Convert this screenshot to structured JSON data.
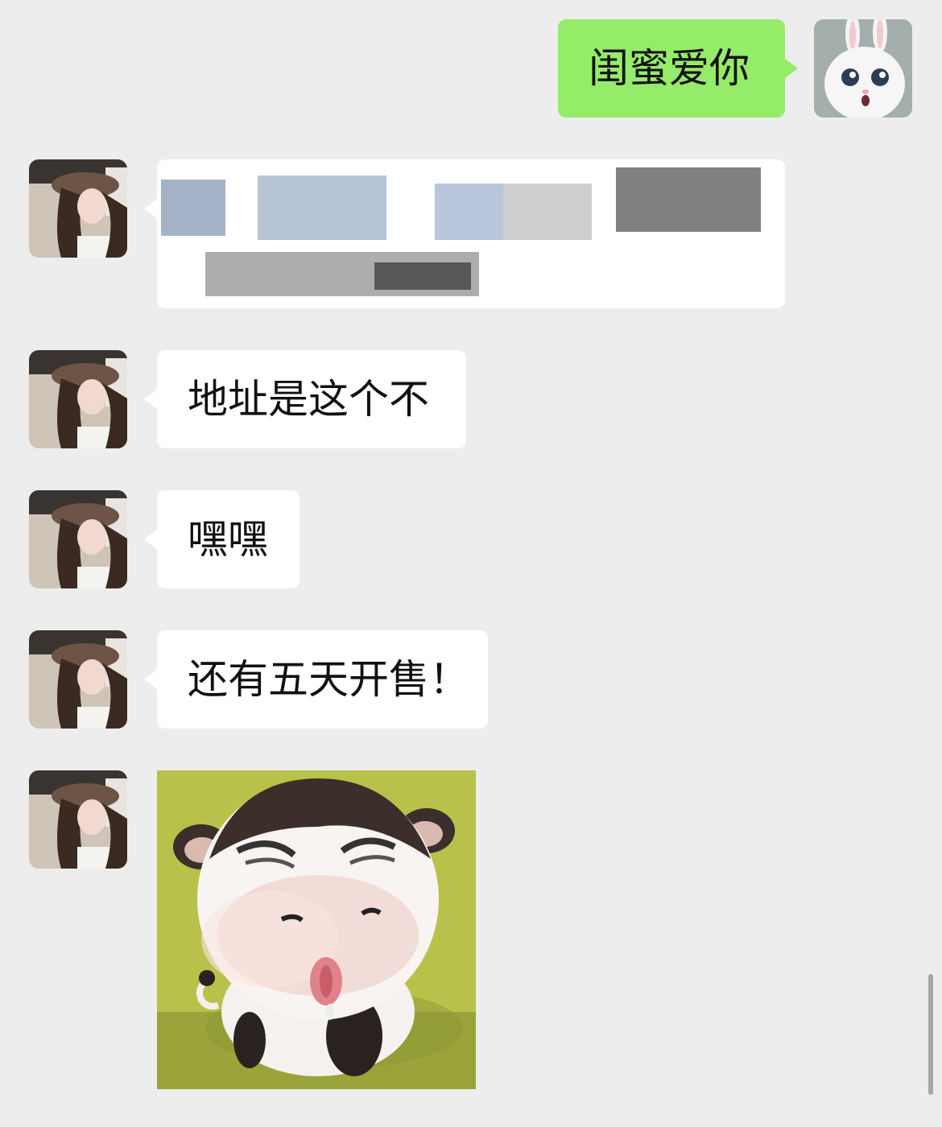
{
  "chat": {
    "messages": [
      {
        "sender": "me",
        "type": "text",
        "text": "闺蜜爱你"
      },
      {
        "sender": "friend",
        "type": "redacted"
      },
      {
        "sender": "friend",
        "type": "text",
        "text": "地址是这个不"
      },
      {
        "sender": "friend",
        "type": "text",
        "text": "嘿嘿"
      },
      {
        "sender": "friend",
        "type": "text",
        "text": "还有五天开售！"
      },
      {
        "sender": "friend",
        "type": "sticker",
        "icon": "cow-sticker"
      }
    ]
  },
  "colors": {
    "background": "#ededed",
    "incoming_bubble": "#ffffff",
    "outgoing_bubble": "#95ec69",
    "text": "#111111"
  }
}
